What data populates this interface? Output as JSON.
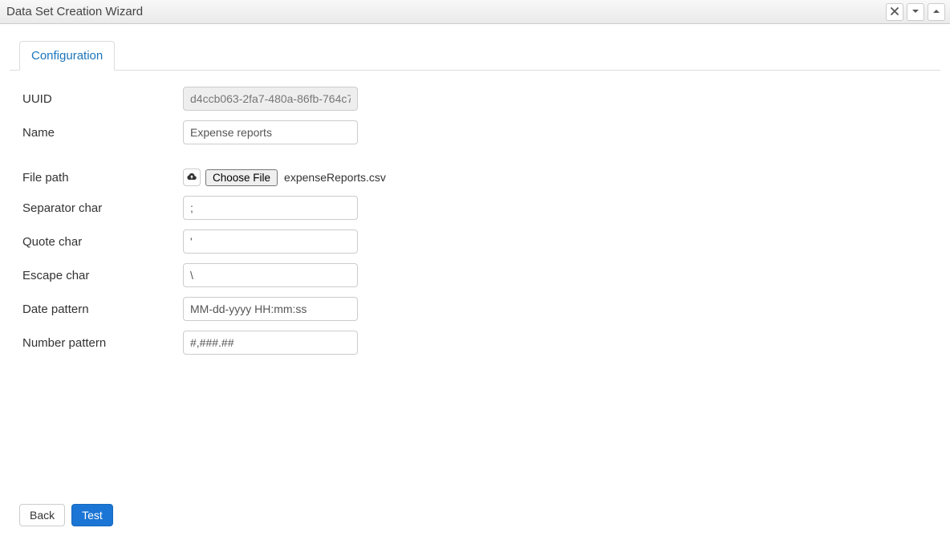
{
  "window": {
    "title": "Data Set Creation Wizard"
  },
  "tabs": {
    "configuration": "Configuration"
  },
  "form": {
    "uuid_label": "UUID",
    "uuid_value": "d4ccb063-2fa7-480a-86fb-764c7",
    "name_label": "Name",
    "name_value": "Expense reports",
    "filepath_label": "File path",
    "choose_file_label": "Choose File",
    "file_name": "expenseReports.csv",
    "separator_label": "Separator char",
    "separator_value": ";",
    "quote_label": "Quote char",
    "quote_value": "'",
    "escape_label": "Escape char",
    "escape_value": "\\",
    "date_pattern_label": "Date pattern",
    "date_pattern_value": "MM-dd-yyyy HH:mm:ss",
    "number_pattern_label": "Number pattern",
    "number_pattern_value": "#,###.##"
  },
  "footer": {
    "back_label": "Back",
    "test_label": "Test"
  }
}
